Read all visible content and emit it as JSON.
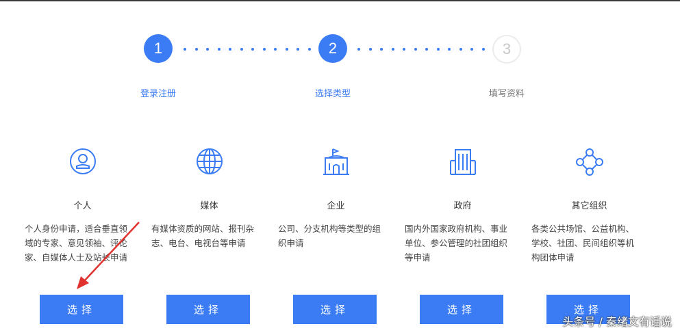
{
  "steps": [
    {
      "number": "1",
      "label": "登录注册",
      "state": "done"
    },
    {
      "number": "2",
      "label": "选择类型",
      "state": "active"
    },
    {
      "number": "3",
      "label": "填写资料",
      "state": "pending"
    }
  ],
  "cards": [
    {
      "title": "个人",
      "icon": "person-icon",
      "desc": "个人身份申请，适合垂直领域的专家、意见领袖、评论家、自媒体人士及站长申请",
      "button": "选择"
    },
    {
      "title": "媒体",
      "icon": "globe-icon",
      "desc": "有媒体资质的网站、报刊杂志、电台、电视台等申请",
      "button": "选择"
    },
    {
      "title": "企业",
      "icon": "enterprise-building-icon",
      "desc": "公司、分支机构等类型的组织申请",
      "button": "选择"
    },
    {
      "title": "政府",
      "icon": "government-building-icon",
      "desc": "国内外国家政府机构、事业单位、参公管理的社团组织等申请",
      "button": "选择"
    },
    {
      "title": "其它组织",
      "icon": "network-nodes-icon",
      "desc": "各类公共场馆、公益机构、学校、社团、民间组织等机构团体申请",
      "button": "选择"
    }
  ],
  "watermark": "头条号 / 秦绪文有话说",
  "colors": {
    "accent": "#3b7cf4",
    "inactive": "#c8c8c8",
    "arrow": "#e0332f"
  }
}
